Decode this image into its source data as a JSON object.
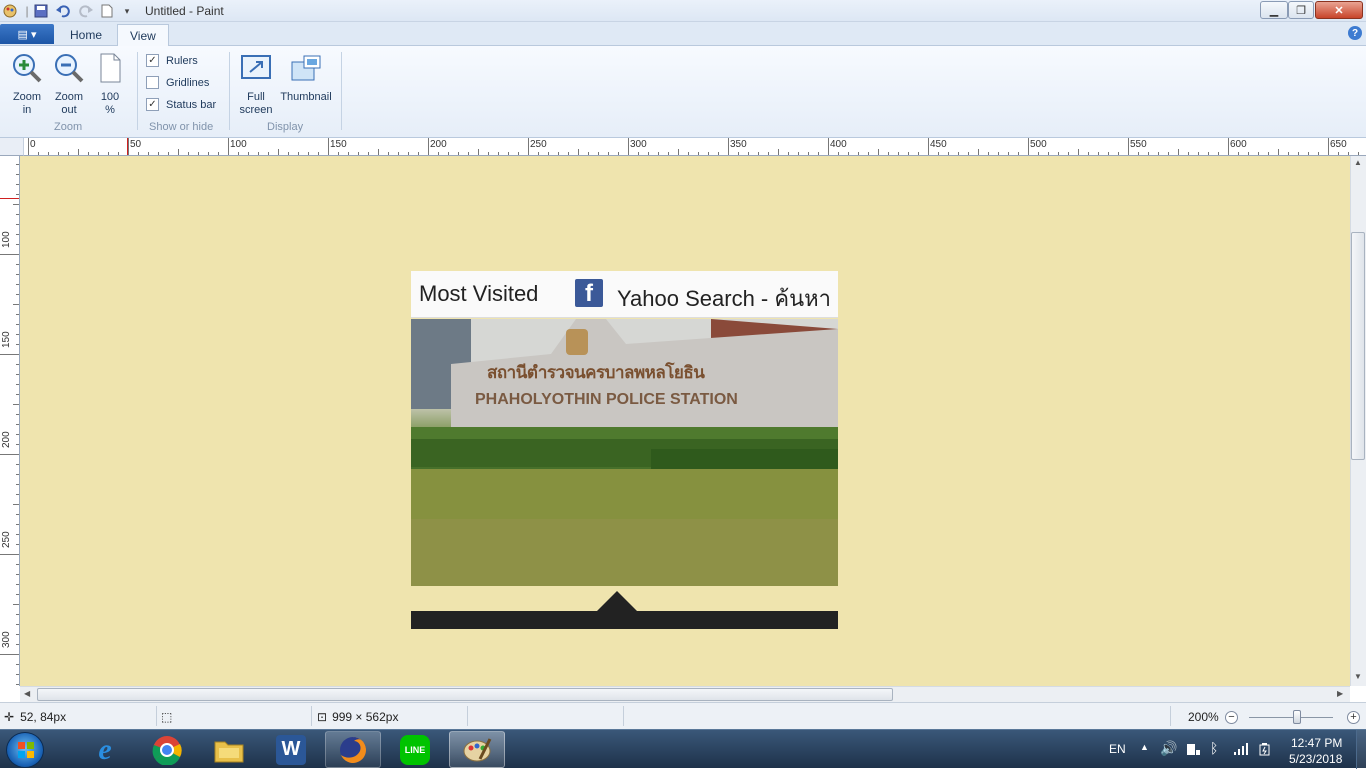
{
  "window": {
    "title": "Untitled - Paint",
    "quick_access": [
      "paint-icon",
      "save-icon",
      "undo-icon",
      "redo-icon",
      "new-document-icon",
      "customize-dropdown-icon"
    ],
    "controls": [
      "minimize-icon",
      "maximize-icon",
      "close-icon"
    ]
  },
  "ribbon": {
    "app_menu_icon": "app-menu-icon",
    "tabs": [
      {
        "label": "Home",
        "active": false
      },
      {
        "label": "View",
        "active": true
      }
    ],
    "groups": {
      "zoom": {
        "label": "Zoom",
        "zoom_in_label": "Zoom in",
        "zoom_in_l1": "Zoom",
        "zoom_in_l2": "in",
        "zoom_out_l1": "Zoom",
        "zoom_out_l2": "out",
        "hundred_l1": "100",
        "hundred_l2": "%"
      },
      "show_or_hide": {
        "label": "Show or hide",
        "rulers": {
          "label": "Rulers",
          "checked": true
        },
        "gridlines": {
          "label": "Gridlines",
          "checked": false
        },
        "status_bar": {
          "label": "Status bar",
          "checked": true
        }
      },
      "display": {
        "label": "Display",
        "full_screen_l1": "Full",
        "full_screen_l2": "screen",
        "thumbnail": "Thumbnail"
      }
    }
  },
  "rulers": {
    "horizontal_labels": [
      "0",
      "50",
      "100",
      "150",
      "200",
      "250",
      "300",
      "350",
      "400",
      "450",
      "500",
      "550",
      "600",
      "650"
    ],
    "vertical_labels": [
      "100",
      "150",
      "200",
      "250",
      "300"
    ]
  },
  "image": {
    "bookmarks_left": "Most Visited",
    "bookmarks_right": "Yahoo Search - ค้นหา",
    "fb_glyph": "f",
    "sign_text_thai": "สถานีตำรวจนครบาลพหลโยธิน",
    "sign_text_en": "PHAHOLYOTHIN POLICE STATION"
  },
  "statusbar": {
    "cursor_pos": "52, 84px",
    "image_size": "999 × 562px",
    "zoom": "200%",
    "zoom_level_fraction": 0.5
  },
  "taskbar": {
    "apps": [
      "internet-explorer-icon",
      "chrome-icon",
      "file-explorer-icon",
      "word-icon",
      "firefox-icon",
      "line-icon",
      "paint-icon"
    ],
    "word_glyph": "W",
    "line_glyph": "LINE",
    "lang": "EN",
    "time": "12:47 PM",
    "date": "5/23/2018"
  }
}
